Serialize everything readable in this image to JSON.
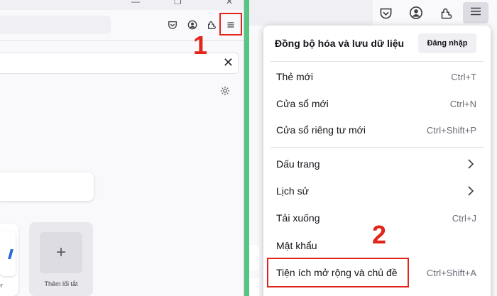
{
  "left": {
    "step_number": "1",
    "new_shortcut_label": "Thêm lối tắt",
    "partial_tile_label": "er",
    "plus_symbol": "+",
    "close_symbol": "✕"
  },
  "menu": {
    "sync_label": "Đồng bộ hóa và lưu dữ liệu",
    "login_label": "Đăng nhập",
    "items": [
      {
        "label": "Thẻ mới",
        "shortcut": "Ctrl+T"
      },
      {
        "label": "Cửa sổ mới",
        "shortcut": "Ctrl+N"
      },
      {
        "label": "Cửa sổ riêng tư mới",
        "shortcut": "Ctrl+Shift+P"
      },
      {
        "label": "Dấu trang",
        "shortcut": ""
      },
      {
        "label": "Lịch sử",
        "shortcut": ""
      },
      {
        "label": "Tải xuống",
        "shortcut": "Ctrl+J"
      },
      {
        "label": "Mật khẩu",
        "shortcut": ""
      },
      {
        "label": "Tiện ích mở rộng và chủ đề",
        "shortcut": "Ctrl+Shift+A"
      }
    ]
  },
  "annotations": {
    "step_two": "2",
    "highlight_color": "#e1251b"
  },
  "colors": {
    "separator_strip": "#57c484"
  }
}
